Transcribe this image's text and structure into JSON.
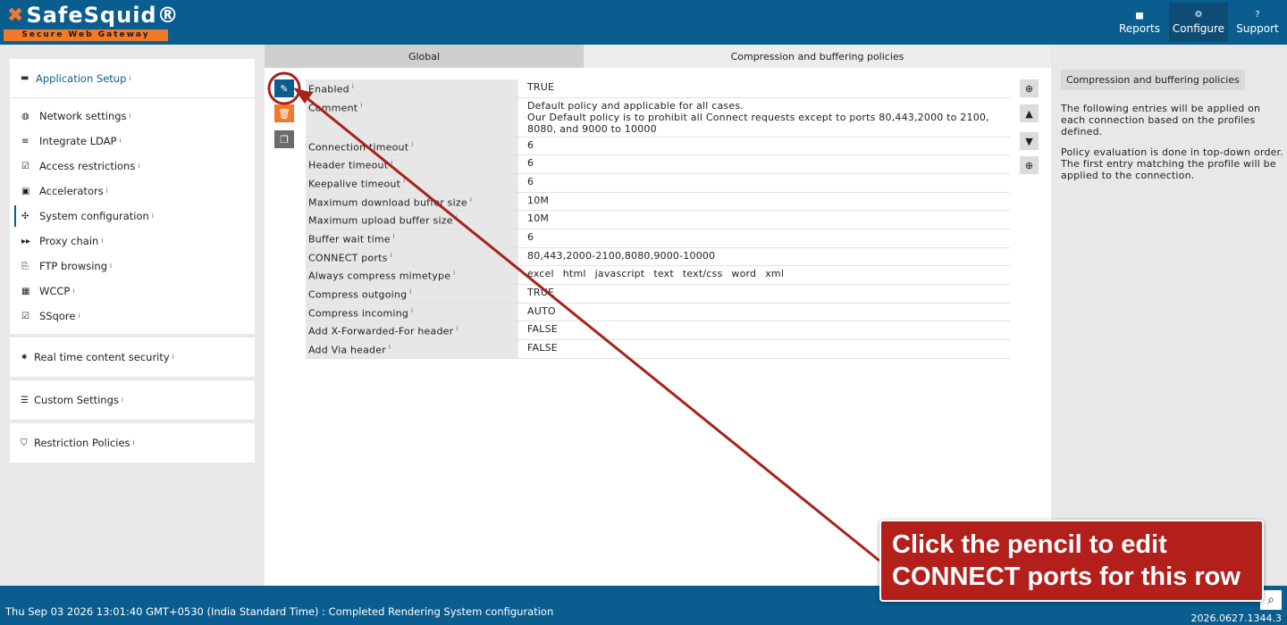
{
  "header": {
    "brand": "SafeSquid®",
    "tagline": "Secure Web Gateway",
    "nav": [
      {
        "label": "Reports",
        "icon": "chart-icon",
        "glyph": "▅"
      },
      {
        "label": "Configure",
        "icon": "gears-icon",
        "glyph": "⚙"
      },
      {
        "label": "Support",
        "icon": "question-icon",
        "glyph": "?"
      }
    ]
  },
  "sidebar": {
    "app_setup": "Application Setup",
    "items": [
      {
        "label": "Network settings",
        "glyph": "◍"
      },
      {
        "label": "Integrate LDAP",
        "glyph": "≡"
      },
      {
        "label": "Access restrictions",
        "glyph": "☑"
      },
      {
        "label": "Accelerators",
        "glyph": "▣"
      },
      {
        "label": "System configuration",
        "glyph": "✣"
      },
      {
        "label": "Proxy chain",
        "glyph": "▸▸"
      },
      {
        "label": "FTP browsing",
        "glyph": "⎘"
      },
      {
        "label": "WCCP",
        "glyph": "▦"
      },
      {
        "label": "SSqore",
        "glyph": "☑"
      }
    ],
    "realtime": "Real time content security",
    "custom": "Custom Settings",
    "restriction": "Restriction Policies",
    "info": "i"
  },
  "tabs": {
    "global": "Global",
    "compression": "Compression and buffering policies"
  },
  "entry": {
    "rows": [
      {
        "key": "Enabled",
        "value": "TRUE"
      },
      {
        "key": "Comment",
        "value_lines": [
          "Default policy and applicable for all cases.",
          "Our Default policy is to prohibit all Connect requests except to ports 80,443,2000 to 2100,",
          "8080, and 9000 to 10000"
        ]
      },
      {
        "key": "Connection timeout",
        "value": "6"
      },
      {
        "key": "Header timeout",
        "value": "6"
      },
      {
        "key": "Keepalive timeout",
        "value": "6"
      },
      {
        "key": "Maximum download buffer size",
        "value": "10M"
      },
      {
        "key": "Maximum upload buffer size",
        "value": "10M"
      },
      {
        "key": "Buffer wait time",
        "value": "6"
      },
      {
        "key": "CONNECT ports",
        "value": "80,443,2000-2100,8080,9000-10000"
      },
      {
        "key": "Always compress mimetype",
        "values": [
          "excel",
          "html",
          "javascript",
          "text",
          "text/css",
          "word",
          "xml"
        ]
      },
      {
        "key": "Compress outgoing",
        "value": "TRUE"
      },
      {
        "key": "Compress incoming",
        "value": "AUTO"
      },
      {
        "key": "Add X-Forwarded-For header",
        "value": "FALSE"
      },
      {
        "key": "Add Via header",
        "value": "FALSE"
      }
    ]
  },
  "right_panel": {
    "title": "Compression and buffering policies",
    "p1": "The following entries will be applied on each connection based on the profiles defined.",
    "p2": "Policy evaluation is done in top-down order. The first entry matching the profile will be applied to the connection."
  },
  "footer": {
    "status": "Thu Sep 03 2026 13:01:40 GMT+0530 (India Standard Time) : Completed Rendering System configuration",
    "version": "2026.0627.1344.3"
  },
  "annotation": {
    "callout": "Click the pencil to edit CONNECT ports for this row",
    "color": "#b3201c"
  },
  "colors": {
    "brand_blue": "#0a5d8f",
    "accent_orange": "#f07a2a"
  }
}
